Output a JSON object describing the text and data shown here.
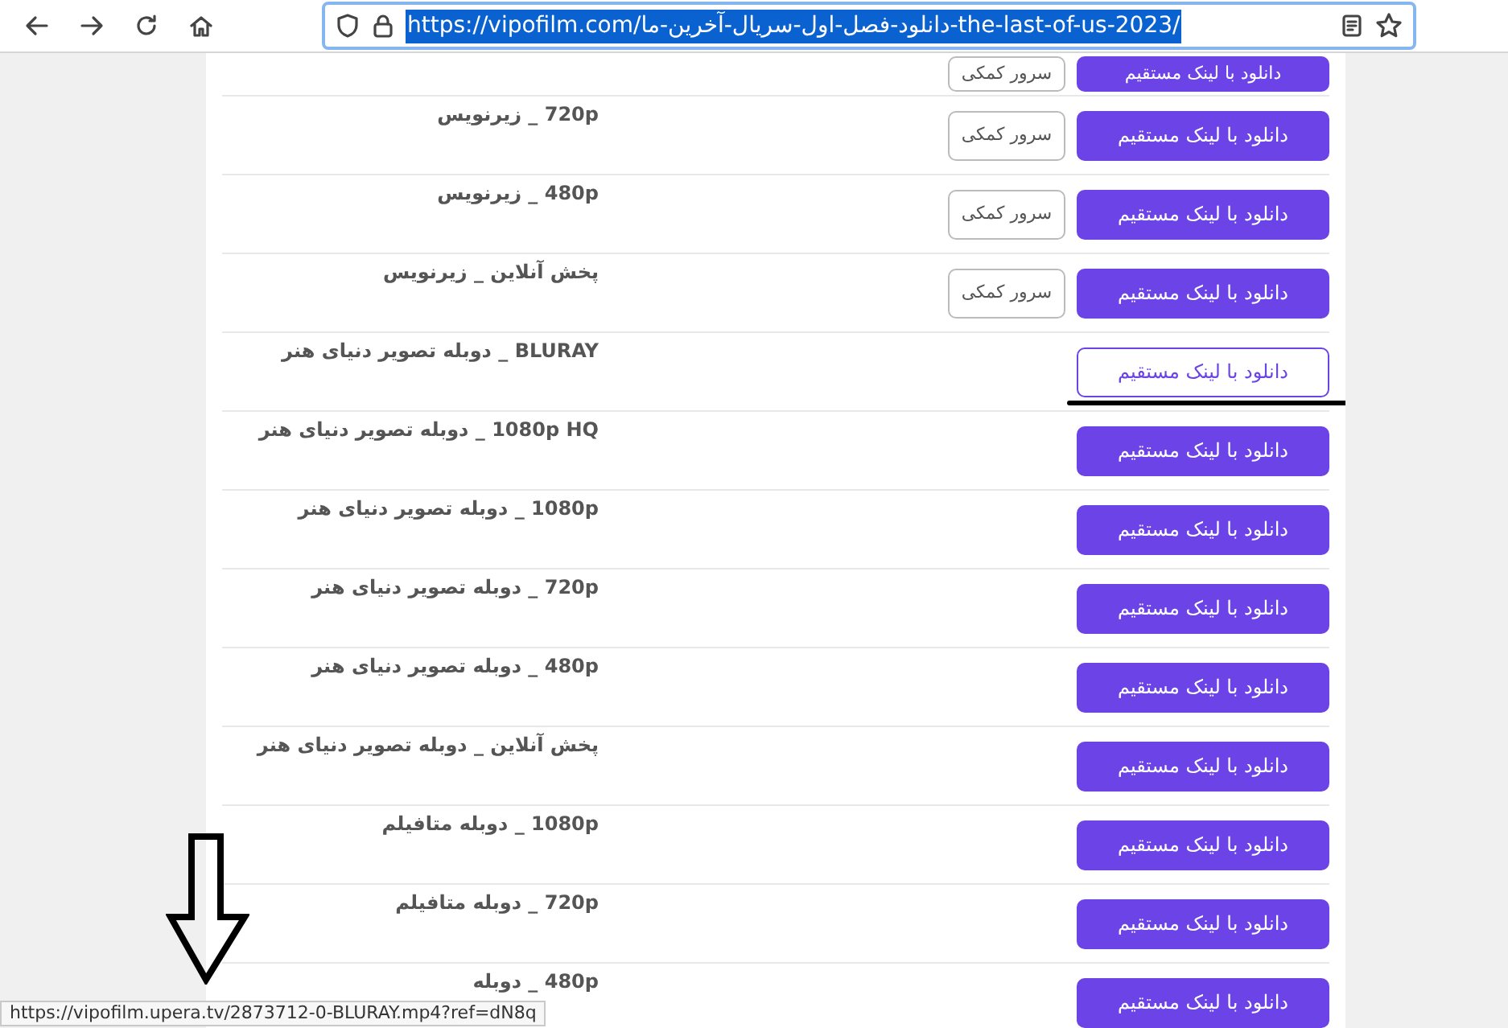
{
  "browser": {
    "url": "https://vipofilm.com/دانلود-فصل-اول-سریال-آخرین-ما-the-last-of-us-2023/",
    "url_selected": true
  },
  "rows": [
    {
      "buttons": [
        {
          "kind": "primary",
          "label": "دانلود با لینک مستقیم",
          "hovered": false
        },
        {
          "kind": "secondary",
          "label": "سرور کمکی"
        }
      ]
    },
    {
      "label": "720p _ زیرنویس",
      "buttons": [
        {
          "kind": "primary",
          "label": "دانلود با لینک مستقیم",
          "hovered": false
        },
        {
          "kind": "secondary",
          "label": "سرور کمکی"
        }
      ]
    },
    {
      "label": "480p _ زیرنویس",
      "buttons": [
        {
          "kind": "primary",
          "label": "دانلود با لینک مستقیم",
          "hovered": false
        },
        {
          "kind": "secondary",
          "label": "سرور کمکی"
        }
      ]
    },
    {
      "label": "پخش آنلاین _ زیرنویس",
      "buttons": [
        {
          "kind": "primary",
          "label": "دانلود با لینک مستقیم",
          "hovered": false
        },
        {
          "kind": "secondary",
          "label": "سرور کمکی"
        }
      ]
    },
    {
      "label": "BLURAY _ دوبله تصویر دنیای هنر",
      "buttons": [
        {
          "kind": "primary",
          "label": "دانلود با لینک مستقیم",
          "hovered": true
        }
      ],
      "underlined": true
    },
    {
      "label": "1080p HQ _ دوبله تصویر دنیای هنر",
      "buttons": [
        {
          "kind": "primary",
          "label": "دانلود با لینک مستقیم",
          "hovered": false
        }
      ]
    },
    {
      "label": "1080p _ دوبله تصویر دنیای هنر",
      "buttons": [
        {
          "kind": "primary",
          "label": "دانلود با لینک مستقیم",
          "hovered": false
        }
      ]
    },
    {
      "label": "720p _ دوبله تصویر دنیای هنر",
      "buttons": [
        {
          "kind": "primary",
          "label": "دانلود با لینک مستقیم",
          "hovered": false
        }
      ]
    },
    {
      "label": "480p _ دوبله تصویر دنیای هنر",
      "buttons": [
        {
          "kind": "primary",
          "label": "دانلود با لینک مستقیم",
          "hovered": false
        }
      ]
    },
    {
      "label": "پخش آنلاین _ دوبله تصویر دنیای هنر",
      "buttons": [
        {
          "kind": "primary",
          "label": "دانلود با لینک مستقیم",
          "hovered": false
        }
      ]
    },
    {
      "label": "1080p _ دوبله متافیلم",
      "buttons": [
        {
          "kind": "primary",
          "label": "دانلود با لینک مستقیم",
          "hovered": false
        }
      ]
    },
    {
      "label": "720p _ دوبله متافیلم",
      "buttons": [
        {
          "kind": "primary",
          "label": "دانلود با لینک مستقیم",
          "hovered": false
        }
      ]
    },
    {
      "label": "480p _ دوبله",
      "buttons": [
        {
          "kind": "primary",
          "label": "دانلود با لینک مستقیم",
          "hovered": false
        }
      ]
    }
  ],
  "status_url": "https://vipofilm.upera.tv/2873712-0-BLURAY.mp4?ref=dN8q",
  "annotation_arrow": true
}
